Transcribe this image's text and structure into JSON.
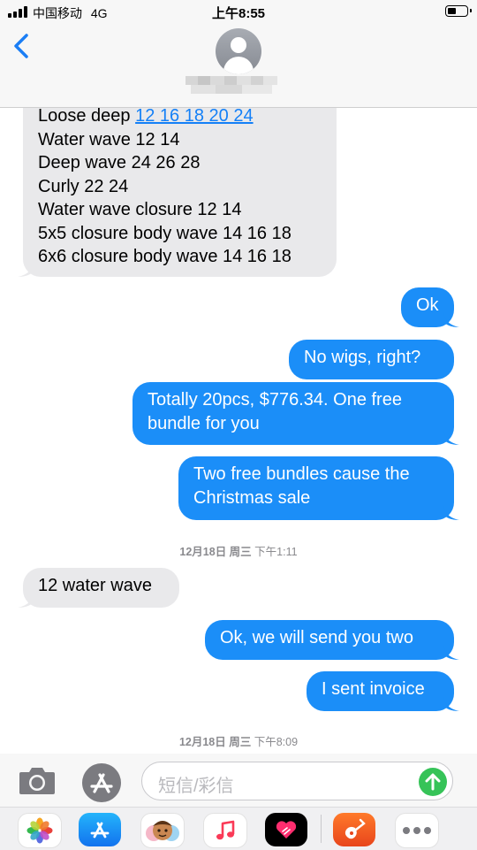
{
  "status_bar": {
    "carrier": "中国移动",
    "network": "4G",
    "time": "上午8:55"
  },
  "header": {
    "contact_name": "",
    "back_icon": "chevron-left-icon"
  },
  "messages": [
    {
      "direction": "in",
      "lines": [
        "Loose deep ",
        "12 16 18 20 24"
      ]
    },
    {
      "direction": "in",
      "text": "Water wave 12 14"
    },
    {
      "direction": "in",
      "text": "Deep wave 24 26 28"
    },
    {
      "direction": "in",
      "text": "Curly 22 24"
    },
    {
      "direction": "in",
      "text": "Water wave closure 12 14"
    },
    {
      "direction": "in",
      "text": "5x5 closure body wave 14 16 18"
    },
    {
      "direction": "in",
      "text": "6x6 closure body wave 14 16 18"
    },
    {
      "direction": "out",
      "text": "Ok"
    },
    {
      "direction": "out",
      "text": "No wigs, right?"
    },
    {
      "direction": "out",
      "lines": [
        "Totally 20pcs, $776.34. One free",
        "bundle for you"
      ]
    },
    {
      "direction": "out",
      "lines": [
        "Two free bundles cause the",
        "Christmas sale"
      ]
    },
    {
      "direction": "in",
      "text": "12 water wave"
    },
    {
      "direction": "out",
      "text": "Ok, we will send you two"
    },
    {
      "direction": "out",
      "text": "I sent invoice"
    }
  ],
  "timestamps": [
    {
      "date": "12月18日 周三",
      "time": "下午1:11"
    },
    {
      "date": "12月18日 周三",
      "time": "下午8:09"
    }
  ],
  "compose": {
    "placeholder": "短信/彩信",
    "camera_icon": "camera-icon",
    "apps_icon": "app-store-icon",
    "send_icon": "arrow-up-icon"
  },
  "app_drawer": [
    "photos-icon",
    "app-store-icon",
    "memoji-icon",
    "music-icon",
    "digital-touch-icon",
    "garageband-icon",
    "more-icon"
  ],
  "colors": {
    "outgoing_bubble": "#1b8ef8",
    "incoming_bubble": "#e9e9eb",
    "link": "#1480f7",
    "send_button": "#36c358"
  }
}
